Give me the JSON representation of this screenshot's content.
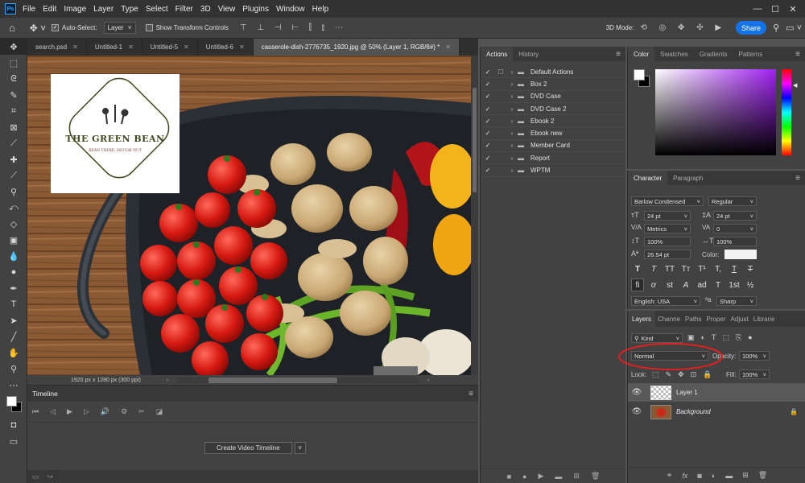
{
  "app": {
    "logo": "Ps",
    "window_controls": [
      "—",
      "☐",
      "✕"
    ]
  },
  "menu": [
    "File",
    "Edit",
    "Image",
    "Layer",
    "Type",
    "Select",
    "Filter",
    "3D",
    "View",
    "Plugins",
    "Window",
    "Help"
  ],
  "options_bar": {
    "auto_select_label": "Auto-Select:",
    "auto_select_checked": true,
    "auto_select_target": "Layer",
    "show_transform_label": "Show Transform Controls",
    "mode_3d_label": "3D Mode:",
    "share_label": "Share"
  },
  "tabs": [
    {
      "label": "search.psd",
      "active": false
    },
    {
      "label": "Untitled-1",
      "active": false
    },
    {
      "label": "Untitled-5",
      "active": false
    },
    {
      "label": "Untitled-6",
      "active": false
    },
    {
      "label": "casserole-dish-2776735_1920.jpg @ 50% (Layer 1, RGB/8#) *",
      "active": true
    }
  ],
  "logo_overlay": {
    "title": "THE GREEN BEAN",
    "subtitle": "BEAN THERE, DOUGH NUT",
    "color": "#3f4a1e"
  },
  "status_bar": {
    "info": "1920 px x 1280 px (300 ppi)"
  },
  "timeline": {
    "title": "Timeline",
    "create_button": "Create Video Timeline"
  },
  "actions_panel": {
    "tabs": [
      "Actions",
      "History"
    ],
    "items": [
      "Default Actions",
      "Box 2",
      "DVD Case",
      "DVD Case 2",
      "Ebook 2",
      "Ebook new",
      "Member Card",
      "Report",
      "WPTM"
    ]
  },
  "color_panel": {
    "tabs": [
      "Color",
      "Swatches",
      "Gradients",
      "Patterns"
    ],
    "fg": "#ffffff",
    "bg": "#000000"
  },
  "character_panel": {
    "tabs": [
      "Character",
      "Paragraph"
    ],
    "font_family": "Barlow Condensed",
    "font_style": "Regular",
    "font_size": "24 pt",
    "leading": "24 pt",
    "kerning": "Metrics",
    "tracking": "0",
    "vertical_scale": "100%",
    "horizontal_scale": "100%",
    "baseline_shift": "26.54 pt",
    "color_label": "Color:",
    "language": "English: USA",
    "antialias": "Sharp",
    "style_buttons": [
      "T",
      "T",
      "TT",
      "Tт",
      "T¹",
      "T,",
      "T",
      "T"
    ],
    "opentype_buttons": [
      "fi",
      "ơ",
      "st",
      "A",
      "ad",
      "T",
      "1st",
      "½"
    ]
  },
  "layers_panel": {
    "tabs": [
      "Layers",
      "Channe",
      "Paths",
      "Proper",
      "Adjust",
      "Librarie"
    ],
    "filter_label": "Kind",
    "blend_mode": "Normal",
    "opacity_label": "Opacity:",
    "opacity_value": "100%",
    "lock_label": "Lock:",
    "fill_label": "Fill:",
    "fill_value": "100%",
    "layers": [
      {
        "name": "Layer 1",
        "selected": true,
        "italic": false
      },
      {
        "name": "Background",
        "selected": false,
        "italic": true
      }
    ],
    "highlight_color": "#e02020"
  }
}
